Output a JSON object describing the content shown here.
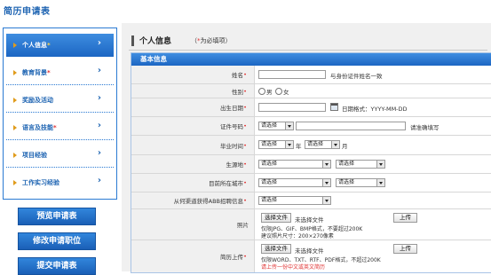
{
  "page_title": "简历申请表",
  "sidebar": {
    "items": [
      {
        "label": "个人信息",
        "required": "*",
        "active": true
      },
      {
        "label": "教育背景",
        "required": "*",
        "active": false
      },
      {
        "label": "奖励及活动",
        "required": "",
        "active": false
      },
      {
        "label": "语言及技能",
        "required": "*",
        "active": false
      },
      {
        "label": "项目经验",
        "required": "",
        "active": false
      },
      {
        "label": "工作实习经验",
        "required": "",
        "active": false
      }
    ],
    "arrow": "›",
    "buttons": {
      "preview": "预览申请表",
      "modify": "修改申请职位",
      "submit": "提交申请表"
    }
  },
  "section": {
    "title": "个人信息",
    "note_prefix": "（",
    "note_star": "*",
    "note_text": "为必填项）"
  },
  "panel": {
    "title": "基本信息"
  },
  "form": {
    "name": {
      "label": "姓名",
      "hint": "与身份证件姓名一致"
    },
    "gender": {
      "label": "性别",
      "male": "男",
      "female": "女"
    },
    "birthday": {
      "label": "出生日期",
      "hint": "日期格式：YYYY-MM-DD"
    },
    "id_number": {
      "label": "证件号码",
      "select": "请选择",
      "hint": "请准确填写"
    },
    "graduation": {
      "label": "毕业时间",
      "year_select": "请选择",
      "year_unit": "年",
      "month_select": "请选择",
      "month_unit": "月"
    },
    "origin": {
      "label": "生源地",
      "select1": "请选择",
      "select2": "请选择"
    },
    "current_city": {
      "label": "目前所在城市",
      "select1": "请选择",
      "select2": "请选择"
    },
    "channel": {
      "label": "从何渠道获得ABB招聘信息",
      "select": "请选择"
    },
    "photo": {
      "label": "照片",
      "choose": "选择文件",
      "no_file": "未选择文件",
      "upload": "上传",
      "note1": "仅限JPG、GIF、BMP格式，不要超过200K",
      "note2": "建议照片尺寸：200×270像素"
    },
    "resume": {
      "label": "简历上传",
      "choose": "选择文件",
      "no_file": "未选择文件",
      "upload": "上传",
      "note1": "仅限WORD、TXT、RTF、PDF格式，不超过200K",
      "note2": "请上传一份中文或英文简历"
    }
  },
  "colors": {
    "brand": "#1b62b1",
    "accent": "#2a7ad3",
    "required": "#e03030",
    "warn": "#e03030"
  }
}
